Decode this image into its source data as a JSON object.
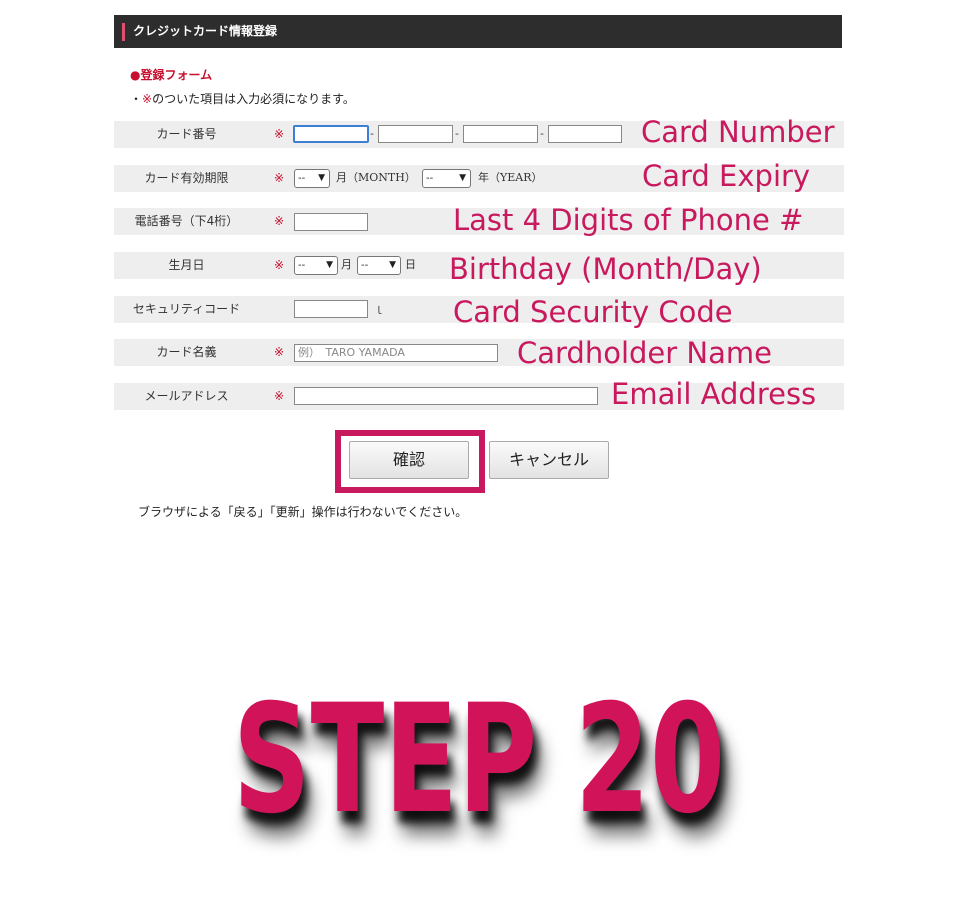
{
  "header": {
    "title": "クレジットカード情報登録"
  },
  "form": {
    "title": "●登録フォーム",
    "note_prefix": "・",
    "note_mark": "※",
    "note_text": "のついた項目は入力必須になります。"
  },
  "rows": {
    "card_number": {
      "label": "カード番号",
      "required": "※",
      "separator": "-",
      "annotation": "Card Number"
    },
    "card_expiry": {
      "label": "カード有効期限",
      "required": "※",
      "month_value": "--",
      "month_unit": "月（MONTH）",
      "year_value": "--",
      "year_unit": "年（YEAR）",
      "annotation": "Card Expiry"
    },
    "phone": {
      "label": "電話番号（下4桁）",
      "required": "※",
      "annotation": "Last 4 Digits of Phone #"
    },
    "birthday": {
      "label": "生月日",
      "required": "※",
      "month_value": "--",
      "month_unit": "月",
      "day_value": "--",
      "day_unit": "日",
      "annotation": "Birthday (Month/Day)"
    },
    "security_code": {
      "label": "セキュリティコード",
      "help": "ｌ",
      "annotation": "Card Security Code"
    },
    "cardholder_name": {
      "label": "カード名義",
      "required": "※",
      "placeholder": "例）　TARO YAMADA",
      "annotation": "Cardholder Name"
    },
    "email": {
      "label": "メールアドレス",
      "required": "※",
      "annotation": "Email Address"
    }
  },
  "buttons": {
    "confirm": "確認",
    "cancel": "キャンセル"
  },
  "footer_note": "ブラウザによる「戻る」「更新」操作は行わないでください。",
  "step_label": "STEP 20",
  "colors": {
    "accent": "#c8195e",
    "required": "#c8102e",
    "header_bg": "#2d2d2d"
  }
}
